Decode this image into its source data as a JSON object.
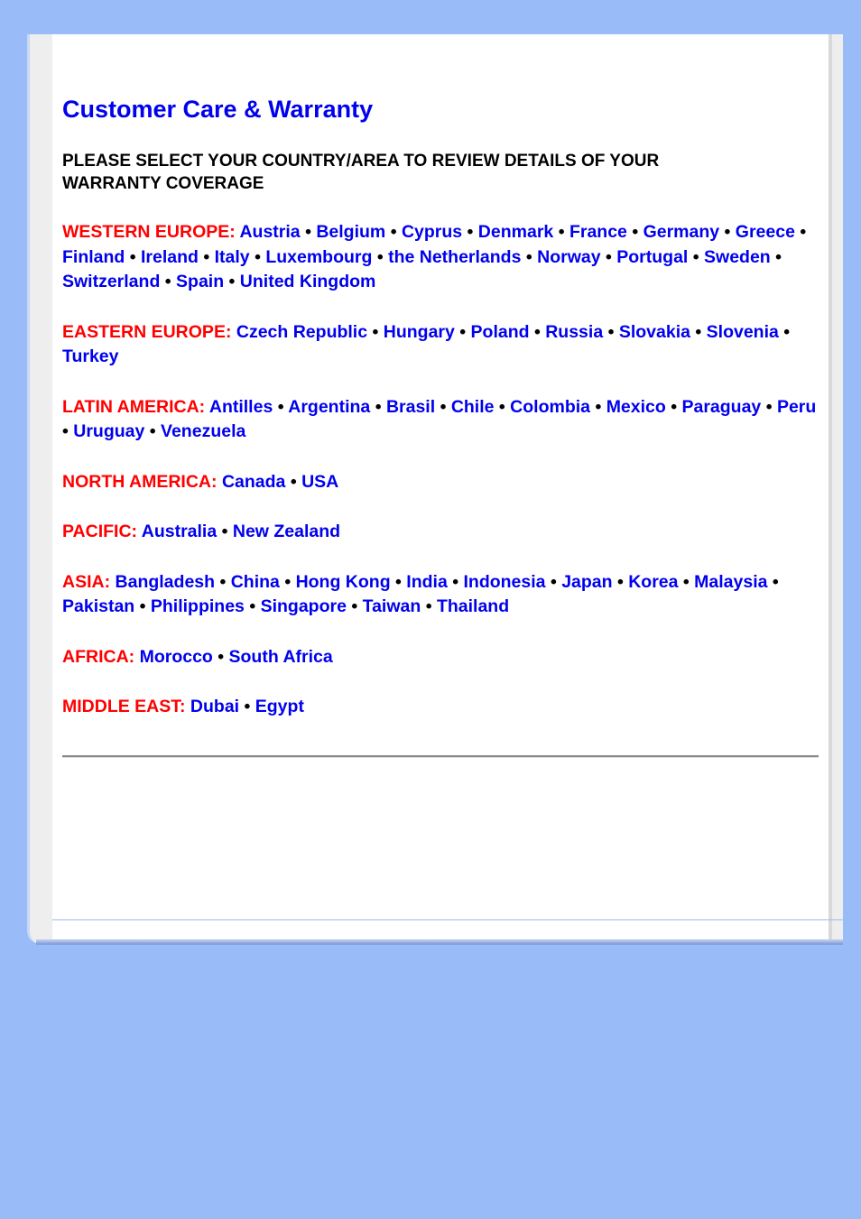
{
  "title": "Customer Care & Warranty",
  "intro": "PLEASE SELECT YOUR COUNTRY/AREA TO REVIEW DETAILS OF YOUR WARRANTY COVERAGE",
  "separator": "•",
  "regions": [
    {
      "label": "WESTERN EUROPE:",
      "countries": [
        "Austria",
        "Belgium",
        "Cyprus",
        "Denmark",
        "France",
        "Germany",
        "Greece",
        "Finland",
        "Ireland",
        "Italy",
        "Luxembourg",
        "the Netherlands",
        "Norway",
        "Portugal",
        "Sweden",
        "Switzerland",
        "Spain",
        "United Kingdom"
      ]
    },
    {
      "label": "EASTERN EUROPE:",
      "countries": [
        "Czech Republic",
        "Hungary",
        "Poland",
        "Russia",
        "Slovakia",
        "Slovenia",
        "Turkey"
      ]
    },
    {
      "label": "LATIN AMERICA:",
      "countries": [
        "Antilles",
        "Argentina",
        "Brasil",
        "Chile",
        "Colombia",
        "Mexico",
        "Paraguay",
        "Peru",
        "Uruguay",
        "Venezuela"
      ]
    },
    {
      "label": "NORTH AMERICA:",
      "countries": [
        "Canada",
        "USA"
      ]
    },
    {
      "label": "PACIFIC:",
      "countries": [
        "Australia",
        "New Zealand"
      ]
    },
    {
      "label": "ASIA:",
      "countries": [
        "Bangladesh",
        "China",
        "Hong Kong",
        "India",
        "Indonesia",
        "Japan",
        "Korea",
        "Malaysia",
        "Pakistan",
        "Philippines",
        "Singapore",
        "Taiwan",
        "Thailand"
      ]
    },
    {
      "label": "AFRICA:",
      "countries": [
        "Morocco",
        "South Africa"
      ]
    },
    {
      "label": "MIDDLE EAST:",
      "countries": [
        "Dubai",
        "Egypt"
      ]
    }
  ],
  "colors": {
    "background": "#99bbf7",
    "link": "#0000ee",
    "region_label": "#ff0000"
  }
}
